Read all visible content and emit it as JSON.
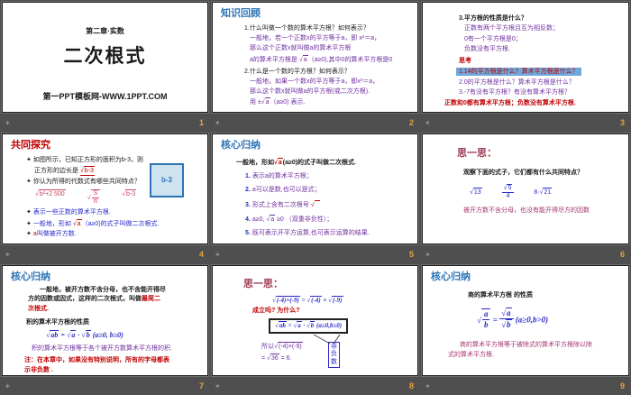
{
  "icons": {
    "star": "✶",
    "bullet": "✦",
    "sqrt_sign": "√"
  },
  "colors": {
    "accent_blue": "#2E74B5",
    "purple": "#7030A0",
    "red": "#C00000",
    "formula_blue": "#2929CC",
    "pink_red": "#C9415E",
    "maroon": "#9E3B52",
    "page_number_orange": "#E8A33D",
    "highlight_bg": "#6FA8DC",
    "square_fill": "#CDE4F0",
    "canvas_gray": "#4f4f4f"
  },
  "slides": {
    "s1": {
      "page": "1",
      "header": "第二章·实数",
      "title": "二次根式",
      "footer": "第一PPT模板网-WWW.1PPT.COM"
    },
    "s2": {
      "page": "2",
      "title": "知识回顾",
      "q1": "1.什么叫做一个数的算术平方根？如何表示？",
      "a1l1": "一般地，若一个正数x的平方等于a，即 x²＝a，",
      "a1l2": "那么这个正数x就叫做a的算术平方根",
      "a1l3": [
        {
          "t": "txt",
          "v": "a的算术平方根是 "
        },
        {
          "t": "sqrt",
          "s": "√",
          "v": "a"
        },
        {
          "t": "txt",
          "v": "（a≥0),其中0的算术平方根是0"
        }
      ],
      "q2": "2.什么是一个数的平方根？如何表示？",
      "a2l1": "一般地，如果一个数x的平方等于a，即x²＝a，",
      "a2l2": "那么这个数x就叫做a的平方根(或二次方根).",
      "a2l3": [
        {
          "t": "txt",
          "v": "用 ±"
        },
        {
          "t": "sqrt",
          "s": "√",
          "v": "a"
        },
        {
          "t": "txt",
          "v": "（a≥0) 表示."
        }
      ]
    },
    "s3": {
      "page": "3",
      "q": "3.平方根的性质是什么？",
      "a1": "正数有两个平方根且互为相反数；",
      "a2": "0有一个平方根是0；",
      "a3": "负数没有平方根.",
      "think": "思考",
      "t1": "1.14的平方根是什么？算术平方根是什么？",
      "t2": "2.0的平方根是什么？算术平方根是什么？",
      "t3": "3.-7有没有平方根？有没有算术平方根？",
      "concl": "正数和0都有算术平方根；负数没有算术平方根."
    },
    "s4": {
      "page": "4",
      "title": "共同探究",
      "b1a": "如图所示，已知正方形的面积为b-3，则",
      "b1b_pre": "正方形的边长是 ",
      "b1b_sqrt": [
        {
          "t": "sqrt",
          "s": "√",
          "v": "b-3"
        }
      ],
      "square_label": "b-3",
      "b2": "你认为所得的代数式有哪些共同特点？",
      "f1": [
        {
          "t": "sqrt",
          "s": "√",
          "v": "b²+2 500"
        }
      ],
      "f2": [
        {
          "t": "sqrt",
          "s": "√",
          "v": [
            {
              "t": "frac",
              "num": "S",
              "den": "π"
            }
          ]
        }
      ],
      "f3": [
        {
          "t": "sqrt",
          "s": "√",
          "v": "b-3"
        }
      ],
      "b3": "表示一些正数的算术平方根.",
      "b4a": "一般地，形如 ",
      "b4b_sqrt": [
        {
          "t": "sqrt",
          "s": "√",
          "v": "a"
        }
      ],
      "b4c": "（a≥0)的式子叫做二次根式.",
      "b5a": "a",
      "b5b": "叫做被开方数."
    },
    "s5": {
      "page": "5",
      "title": "核心归纳",
      "intro_pre": "一般地，形如",
      "intro_sqrt": [
        {
          "t": "sqrt",
          "s": "√",
          "v": "a"
        }
      ],
      "intro_post": "(a≥0)的式子叫做二次根式.",
      "items": [
        {
          "n": "1.",
          "f": [
            {
              "t": "txt",
              "v": "表示a的算术平方根；"
            }
          ]
        },
        {
          "n": "2.",
          "f": [
            {
              "t": "txt",
              "v": "a可以是数,也可以是式；"
            }
          ]
        },
        {
          "n": "3.",
          "f": [
            {
              "t": "txt",
              "v": "形式上含有二次根号 "
            }
          ],
          "fr": [
            {
              "t": "sqrt",
              "s": "√",
              "v": "  "
            }
          ]
        },
        {
          "n": "4.",
          "f": [
            {
              "t": "txt",
              "v": "a≥0, "
            },
            {
              "t": "sqrt",
              "s": "√",
              "v": "a"
            },
            {
              "t": "txt",
              "v": " ≥0 （双重非负性）；"
            }
          ]
        },
        {
          "n": "5.",
          "f": [
            {
              "t": "txt",
              "v": "既可表示开平方运算,也可表示运算的结果."
            }
          ]
        }
      ]
    },
    "s6": {
      "page": "6",
      "title": "思一思：",
      "q": "观察下面的式子，它们都有什么共同特点？",
      "f1": [
        {
          "t": "sqrt",
          "s": "√",
          "v": "13"
        }
      ],
      "f2": [
        {
          "t": "frac",
          "num": [
            {
              "t": "sqrt",
              "s": "√",
              "v": "5"
            }
          ],
          "den": "4"
        }
      ],
      "f3": [
        {
          "t": "txt",
          "v": "8·"
        },
        {
          "t": "sqrt",
          "s": "√",
          "v": "21"
        }
      ],
      "a": "被开方数不含分母，也没有能开得尽方的因数"
    },
    "s7": {
      "page": "7",
      "title": "核心归纳",
      "p1_l1": "一般地，被开方数不含分母，也不含能开得尽",
      "p1_l2a": "方的因数或因式，这样的二次根式，叫做",
      "p1_l2b": "最简二",
      "p1_l3": "次根式.",
      "sub": "积的算术平方根的性质",
      "formula": [
        {
          "t": "sqrt",
          "s": "√",
          "v": "ab"
        },
        {
          "t": "txt",
          "v": " = "
        },
        {
          "t": "sqrt",
          "s": "√",
          "v": "a"
        },
        {
          "t": "txt",
          "v": " · "
        },
        {
          "t": "sqrt",
          "s": "√",
          "v": "b"
        },
        {
          "t": "txt",
          "v": " (a≥0, b≥0)"
        }
      ],
      "note": "积的算术平方根等于各个被开方数算术平方根的积.",
      "warn_l1": "注：在本章中，如果没有特别说明，所有的字母都表",
      "warn_l2": "示非负数 ."
    },
    "s8": {
      "page": "8",
      "title": "思一思：",
      "f1": [
        {
          "t": "sqrt",
          "s": "√",
          "v": "(-4)×(-9)"
        },
        {
          "t": "txt",
          "v": " = "
        },
        {
          "t": "sqrt",
          "s": "√",
          "v": "(-4)"
        },
        {
          "t": "txt",
          "v": " × "
        },
        {
          "t": "sqrt",
          "s": "√",
          "v": "(-9)"
        }
      ],
      "q": "成立吗? 为什么?",
      "box": [
        {
          "t": "sqrt",
          "s": "√",
          "v": "ab"
        },
        {
          "t": "txt",
          "v": " = "
        },
        {
          "t": "sqrt",
          "s": "√",
          "v": "a"
        },
        {
          "t": "txt",
          "v": " · "
        },
        {
          "t": "sqrt",
          "s": "√",
          "v": "b"
        },
        {
          "t": "txt",
          "v": " (a≥0,b≥0)"
        }
      ],
      "so1": [
        {
          "t": "txt",
          "v": "所以"
        },
        {
          "t": "sqrt",
          "s": "√",
          "v": "(-4)×(-9)"
        }
      ],
      "so2": [
        {
          "t": "txt",
          "v": "= "
        },
        {
          "t": "sqrt",
          "s": "√",
          "v": "36"
        },
        {
          "t": "txt",
          "v": " = 6."
        }
      ],
      "tag": "非负数"
    },
    "s9": {
      "page": "9",
      "title": "核心归纳",
      "sub": "商的算术平方根 的性质",
      "formula": [
        {
          "t": "sqrt",
          "s": "√",
          "v": [
            {
              "t": "frac",
              "num": "a",
              "den": "b"
            }
          ]
        },
        {
          "t": "txt",
          "v": " = "
        },
        {
          "t": "frac",
          "num": [
            {
              "t": "sqrt",
              "s": "√",
              "v": "a"
            }
          ],
          "den": [
            {
              "t": "sqrt",
              "s": "√",
              "v": "b"
            }
          ]
        },
        {
          "t": "txt",
          "v": " (a≥0,b>0)"
        }
      ],
      "p_l1": "商的算术平方根等于被除式的算术平方根除以除",
      "p_l2": "式的算术平方根."
    }
  }
}
